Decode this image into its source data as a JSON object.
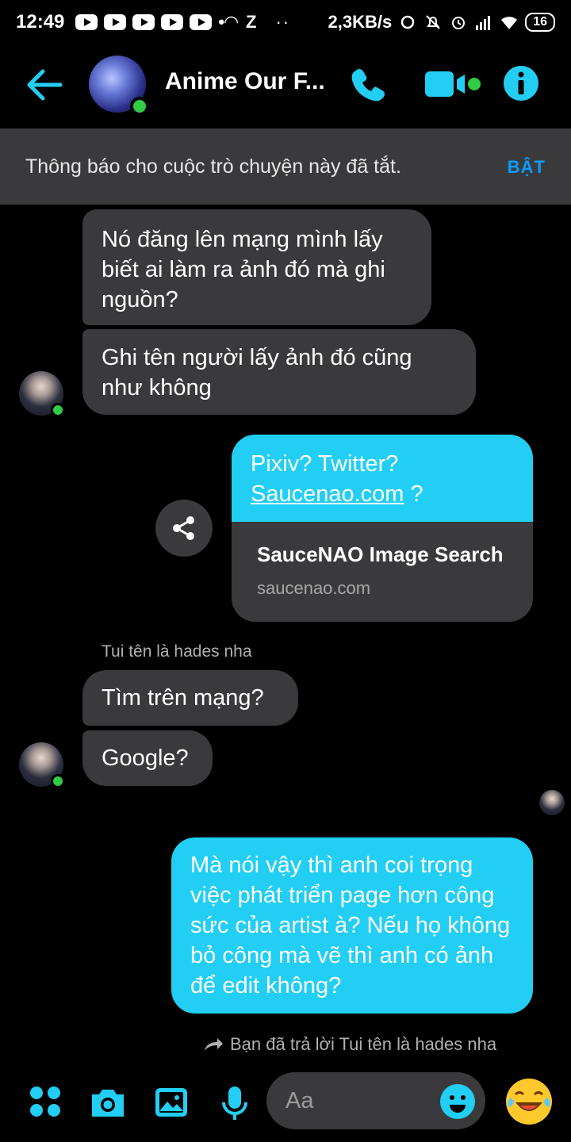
{
  "status_bar": {
    "time": "12:49",
    "speed": "2,3KB/s",
    "battery": "16",
    "misc": "Z"
  },
  "header": {
    "title": "Anime Our F...",
    "back_icon": "arrow-left-icon",
    "call_icon": "phone-icon",
    "video_icon": "video-camera-icon",
    "info_icon": "info-icon",
    "accent": "#22cef3"
  },
  "banner": {
    "text": "Thông báo cho cuộc trò chuyện này đã tắt.",
    "action": "BẬT"
  },
  "messages": {
    "m1": "Nó đăng lên mạng mình lấy biết ai làm ra ảnh đó mà ghi nguồn?",
    "m2": "Ghi tên người lấy ảnh đó cũng như không",
    "link_text_1": "Pixiv? Twitter?",
    "link_text_2": "Saucenao.com",
    "link_text_3": " ?",
    "link_title": "SauceNAO Image Search",
    "link_domain": "saucenao.com",
    "sender_label": "Tui tên là hades nha",
    "m3": "Tìm trên mạng?",
    "m4": "Google?",
    "m5": "Mà nói vậy thì anh coi trọng việc phát triển page hơn công sức của artist à? Nếu họ không bỏ công mà vẽ thì anh có ảnh để edit không?",
    "reply_note": "Bạn đã trả lời Tui tên là hades nha"
  },
  "composer": {
    "placeholder": "Aa"
  },
  "colors": {
    "incoming": "#3a3a3c",
    "outgoing": "#22cef3",
    "online": "#31cc46",
    "banner_action": "#0a9cff"
  }
}
